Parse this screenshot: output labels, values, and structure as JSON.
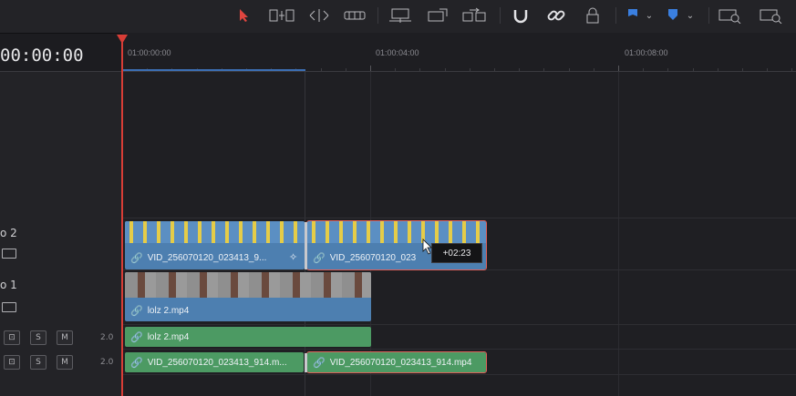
{
  "timeline": {
    "timecode": "00:00:00",
    "ruler_labels": [
      "01:00:00:00",
      "01:00:04:00",
      "01:00:08:00"
    ]
  },
  "tracks": {
    "video2": {
      "name": "o 2"
    },
    "video1": {
      "name": "o 1"
    },
    "audio1": {
      "volume": "2.0",
      "solo": "S",
      "mute": "M"
    },
    "audio2": {
      "volume": "2.0",
      "solo": "S",
      "mute": "M"
    }
  },
  "clips": {
    "v2_clip1": "VID_256070120_023413_9...",
    "v2_clip2": "VID_256070120_023",
    "v1_clip1": "lolz 2.mp4",
    "a1_clip1": "lolz 2.mp4",
    "a2_clip1": "VID_256070120_023413_914.m...",
    "a2_clip2": "VID_256070120_023413_914.mp4"
  },
  "tooltip": {
    "text": "+02:23"
  },
  "colors": {
    "playhead": "#d83d36",
    "video_clip": "#4d7fb0",
    "audio_clip": "#4c9a63",
    "selection": "#e0605a"
  },
  "icons": [
    "selection-arrow-icon",
    "trim-icon",
    "dynamic-trim-icon",
    "blade-icon",
    "insert-icon",
    "overwrite-icon",
    "replace-icon",
    "snapping-icon",
    "linked-selection-icon",
    "position-lock-icon",
    "flag-icon",
    "marker-icon",
    "zoom-full-icon",
    "zoom-detail-icon"
  ]
}
